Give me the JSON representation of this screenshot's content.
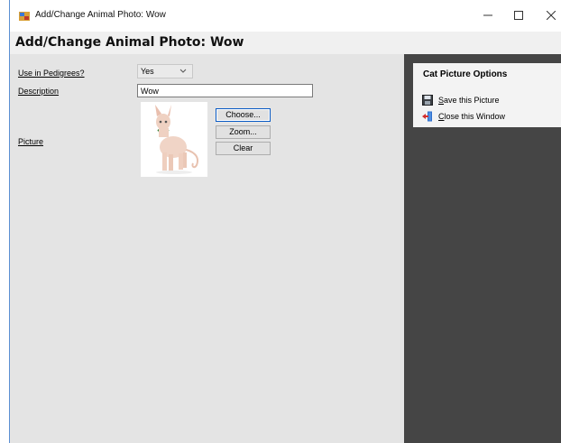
{
  "window": {
    "title": "Add/Change Animal Photo: Wow"
  },
  "header": {
    "title": "Add/Change Animal Photo: Wow"
  },
  "form": {
    "use_in_pedigrees_label": "Use in Pedigrees?",
    "use_in_pedigrees_value": "Yes",
    "description_label": "Description",
    "description_value": "Wow",
    "picture_label": "Picture",
    "choose_label": "Choose...",
    "zoom_label": "Zoom...",
    "clear_label": "Clear"
  },
  "options": {
    "title": "Cat Picture Options",
    "items": [
      {
        "label": "Save this Picture",
        "icon": "floppy-disk-icon"
      },
      {
        "label": "Close this Window",
        "icon": "exit-door-icon"
      }
    ]
  },
  "colors": {
    "panel_dark": "#454545",
    "form_bg": "#e4e4e4",
    "accent_border": "#0a5bc4"
  }
}
